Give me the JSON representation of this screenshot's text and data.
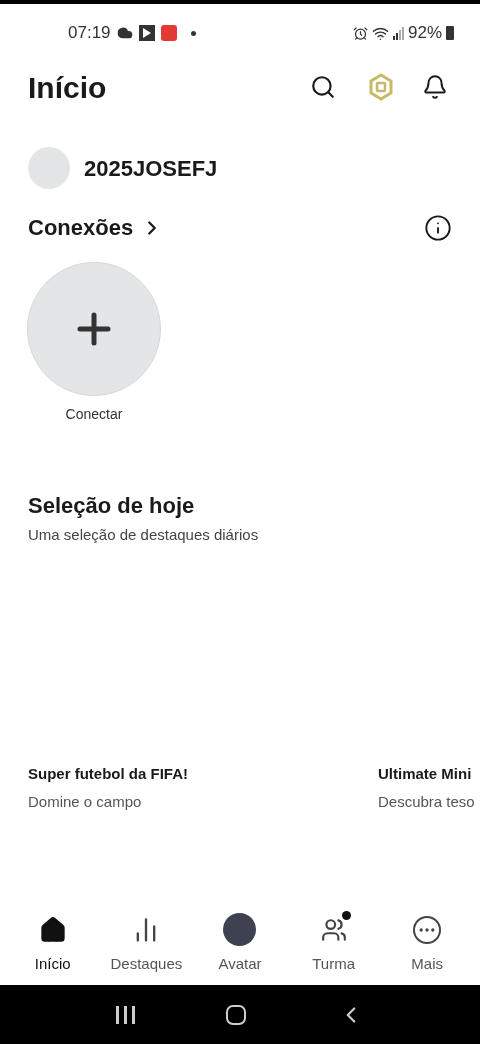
{
  "status_bar": {
    "time": "07:19",
    "battery": "92%"
  },
  "header": {
    "title": "Início"
  },
  "user": {
    "name": "2025JOSEFJ"
  },
  "connections": {
    "title": "Conexões",
    "add_label": "Conectar"
  },
  "today": {
    "title": "Seleção de hoje",
    "subtitle": "Uma seleção de destaques diários",
    "games": [
      {
        "title": "Super futebol da FIFA!",
        "subtitle": "Domine o campo"
      },
      {
        "title": "Ultimate Mini",
        "subtitle": "Descubra teso"
      }
    ]
  },
  "nav": [
    {
      "kind": "home",
      "label": "Início",
      "selected": true,
      "badge": false
    },
    {
      "kind": "chart",
      "label": "Destaques",
      "selected": false,
      "badge": false
    },
    {
      "kind": "avatar",
      "label": "Avatar",
      "selected": false,
      "badge": false
    },
    {
      "kind": "group",
      "label": "Turma",
      "selected": false,
      "badge": true
    },
    {
      "kind": "more",
      "label": "Mais",
      "selected": false,
      "badge": false
    }
  ]
}
